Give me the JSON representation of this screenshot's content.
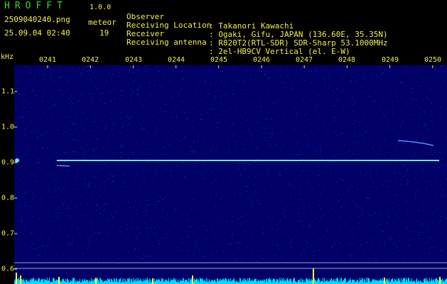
{
  "header": {
    "app_name": "HROFFT",
    "app_version": "1.0.0",
    "filename": "2509040240.png",
    "timestamp": "25.09.04 02:40",
    "event_type": "meteor",
    "event_count": "19",
    "info": [
      {
        "key": "Observer",
        "value": ": Takanori Kawachi"
      },
      {
        "key": "Receiving Location",
        "value": ": Ogaki, Gifu, JAPAN (136.60E, 35.35N)"
      },
      {
        "key": "Receiver",
        "value": ": R820T2(RTL-SDR) SDR-Sharp 53.1000MHz"
      },
      {
        "key": "Receiving antenna",
        "value": ": 2el-HB9CV Vertical (el. E-W)"
      }
    ]
  },
  "plot": {
    "unit": "kHz",
    "time_ticks": [
      "0241",
      "0242",
      "0243",
      "0244",
      "0245",
      "0246",
      "0247",
      "0248",
      "0249",
      "0250"
    ],
    "freq_ticks": [
      "1.1",
      "1.0",
      "0.9",
      "0.8",
      "0.7",
      "0.6"
    ],
    "colors": {
      "background": "#000066",
      "noise": "#2a3fd0",
      "carrier": "#7fdcff",
      "power_bar": "#00d8ff",
      "spike": "#ffff33",
      "grid": "#9aa6c8"
    }
  }
}
